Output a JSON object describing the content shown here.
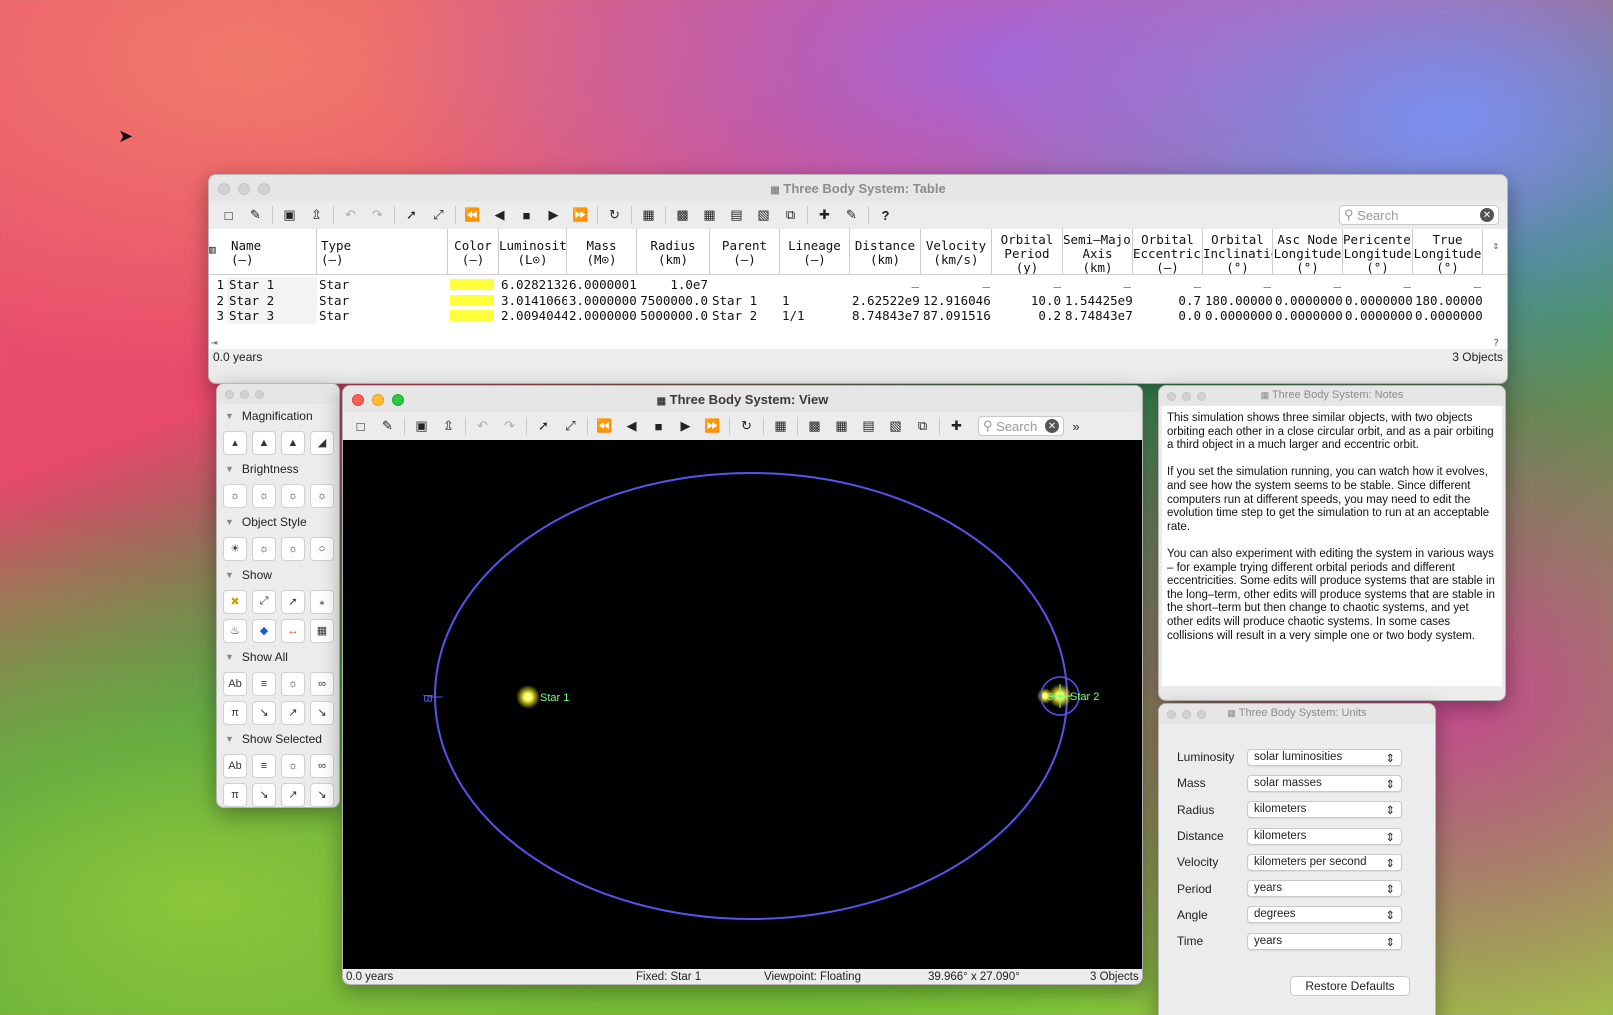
{
  "table_window": {
    "title": "Three Body System: Table",
    "search_placeholder": "Search",
    "status_left": "0.0 years",
    "status_right": "3 Objects",
    "columns": [
      {
        "l1": "Name",
        "l2": "(–)"
      },
      {
        "l1": "Type",
        "l2": "(–)"
      },
      {
        "l1": "Color",
        "l2": "(–)"
      },
      {
        "l1": "Luminosity",
        "l2": "(L⊙)"
      },
      {
        "l1": "Mass",
        "l2": "(M⊙)"
      },
      {
        "l1": "Radius",
        "l2": "(km)"
      },
      {
        "l1": "Parent",
        "l2": "(–)"
      },
      {
        "l1": "Lineage",
        "l2": "(–)"
      },
      {
        "l1": "Distance",
        "l2": "(km)"
      },
      {
        "l1": "Velocity",
        "l2": "(km/s)"
      },
      {
        "l1": "Orbital",
        "l2": "Period",
        "l3": "(y)"
      },
      {
        "l1": "Semi–Major",
        "l2": "Axis",
        "l3": "(km)"
      },
      {
        "l1": "Orbital",
        "l2": "Eccentrici",
        "l3": "(–)"
      },
      {
        "l1": "Orbital",
        "l2": "Inclinatio",
        "l3": "(°)"
      },
      {
        "l1": "Asc Node",
        "l2": "Longitude",
        "l3": "(°)"
      },
      {
        "l1": "Pericenter",
        "l2": "Longitude",
        "l3": "(°)"
      },
      {
        "l1": "True",
        "l2": "Longitude",
        "l3": "(°)"
      }
    ],
    "rows": [
      {
        "n": "1",
        "name": "Star 1",
        "type": "Star",
        "color": "#ffff3c",
        "lum": "6.0282132",
        "mass": "6.0000001",
        "radius": "1.0e7",
        "parent": "",
        "lineage": "",
        "distance": "_",
        "velocity": "_",
        "period": "_",
        "sma": "_",
        "ecc": "_",
        "inc": "_",
        "asc": "_",
        "peri": "_",
        "truelon": "_"
      },
      {
        "n": "2",
        "name": "Star 2",
        "type": "Star",
        "color": "#ffff3c",
        "lum": "3.0141066",
        "mass": "3.0000000",
        "radius": "7500000.0",
        "parent": "Star 1",
        "lineage": "1",
        "distance": "2.62522e9",
        "velocity": "12.916046",
        "period": "10.0",
        "sma": "1.54425e9",
        "ecc": "0.7",
        "inc": "180.00000",
        "asc": "0.0000000",
        "peri": "0.0000000",
        "truelon": "180.00000"
      },
      {
        "n": "3",
        "name": "Star 3",
        "type": "Star",
        "color": "#ffff3c",
        "lum": "2.0094044",
        "mass": "2.0000000",
        "radius": "5000000.0",
        "parent": "Star 2",
        "lineage": "1/1",
        "distance": "8.74843e7",
        "velocity": "87.091516",
        "period": "0.2",
        "sma": "8.74843e7",
        "ecc": "0.0",
        "inc": "0.0000000",
        "asc": "0.0000000",
        "peri": "0.0000000",
        "truelon": "0.0000000"
      }
    ]
  },
  "palette": {
    "sections": [
      "Magnification",
      "Brightness",
      "Object Style",
      "Show",
      "Show All",
      "Show Selected"
    ]
  },
  "view_window": {
    "title": "Three Body System: View",
    "search_placeholder": "Search",
    "status_time": "0.0 years",
    "status_fixed": "Fixed: Star 1",
    "status_viewpoint": "Viewpoint: Floating",
    "status_fov": "39.966° x 27.090°",
    "status_objects": "3 Objects",
    "star1_label": "Star 1",
    "star2_label": "Star 2",
    "star3_label": "Star",
    "omega_label": "ϖ"
  },
  "notes_window": {
    "title": "Three Body System: Notes",
    "paragraphs": [
      "This simulation shows three similar objects, with two objects orbiting each other in a close circular orbit, and as a pair orbiting a third object in a much larger and eccentric orbit.",
      "If you set the simulation running, you can watch how it evolves, and see how the system seems to be stable.  Since different computers run at different speeds, you may need to edit the evolution time step to get the simulation to run at an acceptable rate.",
      "You can also experiment with editing the system in various ways – for example trying different orbital periods and different eccentricities.  Some edits will produce systems that are stable in the long–term, other edits will produce systems that are stable in the short–term but then change to chaotic systems, and yet other edits will produce chaotic systems.  In some cases collisions will result in a very simple one or two body system."
    ]
  },
  "units_window": {
    "title": "Three Body System: Units",
    "rows": [
      {
        "label": "Luminosity",
        "value": "solar luminosities"
      },
      {
        "label": "Mass",
        "value": "solar masses"
      },
      {
        "label": "Radius",
        "value": "kilometers"
      },
      {
        "label": "Distance",
        "value": "kilometers"
      },
      {
        "label": "Velocity",
        "value": "kilometers per second"
      },
      {
        "label": "Period",
        "value": "years"
      },
      {
        "label": "Angle",
        "value": "degrees"
      },
      {
        "label": "Time",
        "value": "years"
      }
    ],
    "restore_label": "Restore Defaults"
  },
  "colors": {
    "orbit": "#5555ee",
    "star": "#ffff66",
    "label": "#7cff7c"
  }
}
